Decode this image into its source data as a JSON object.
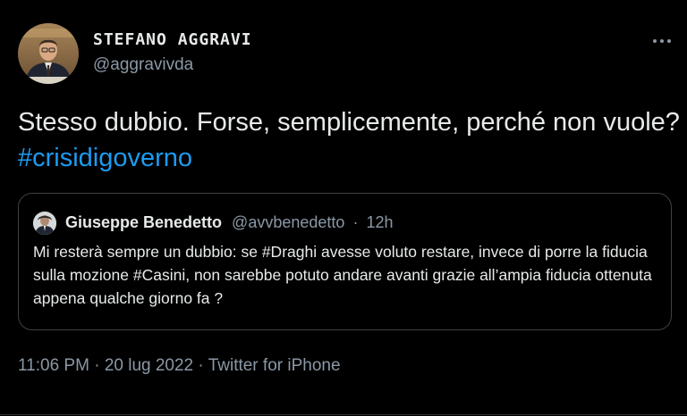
{
  "author": {
    "name": "STEFANO AGGRAVI",
    "handle": "@aggravivda"
  },
  "tweet": {
    "text": "Stesso dubbio. Forse, semplicemente, perché non vuole?",
    "hashtag": "#crisidigoverno"
  },
  "quoted_tweet": {
    "author_name": "Giuseppe Benedetto",
    "author_handle": "@avvbenedetto",
    "separator": "·",
    "age": "12h",
    "text": "Mi resterà sempre un dubbio: se #Draghi avesse voluto restare, invece di porre la fiducia sulla mozione #Casini, non sarebbe potuto andare avanti grazie  all’ampia fiducia ottenuta appena qualche giorno fa ?"
  },
  "meta": {
    "time": "11:06 PM",
    "date": "20 lug 2022",
    "source": "Twitter for iPhone",
    "separator": "·"
  },
  "icons": {
    "more": "more-horizontal-icon"
  },
  "colors": {
    "background": "#000000",
    "text_primary": "#e7e9ea",
    "text_secondary": "#8b98a5",
    "link": "#1d9bf0",
    "border": "#3e4144"
  }
}
